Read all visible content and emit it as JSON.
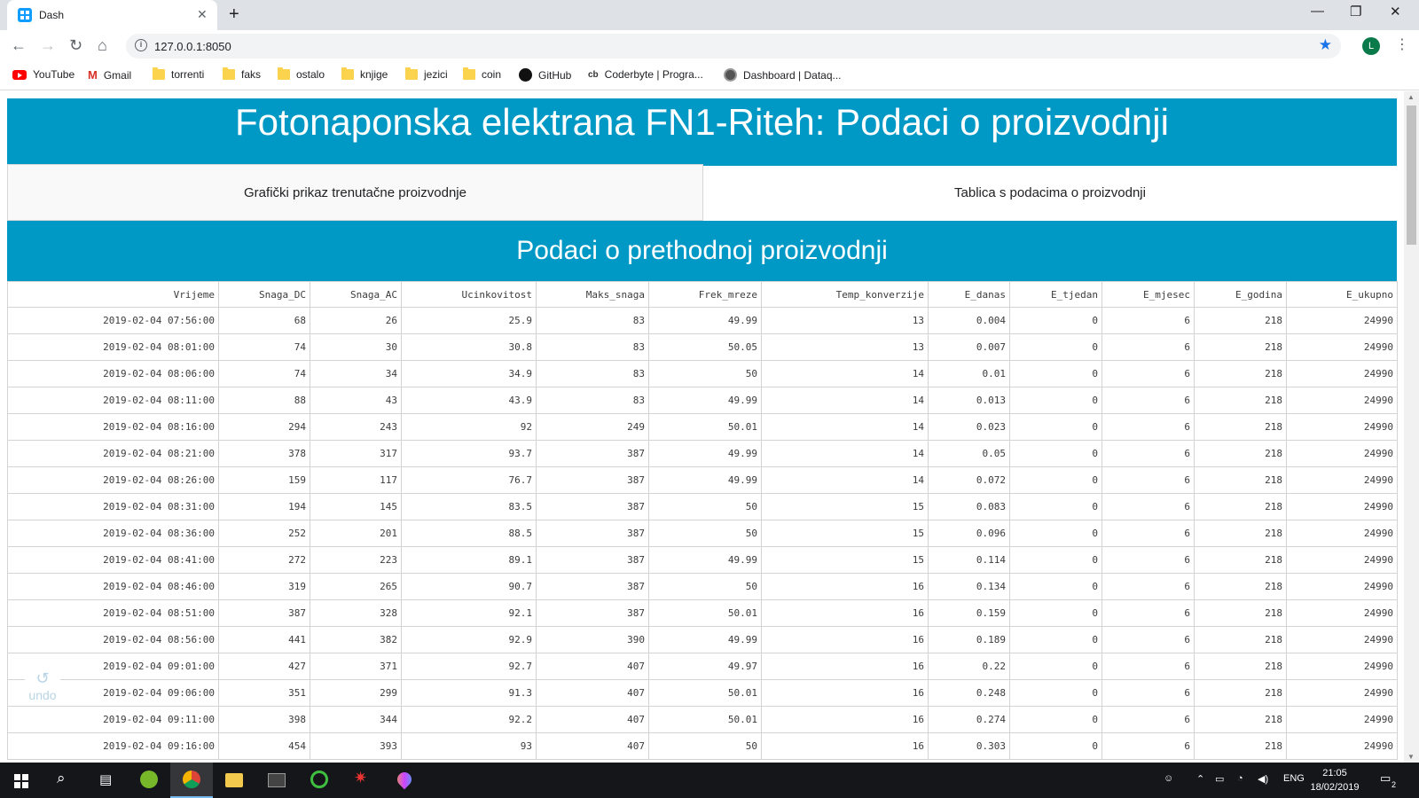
{
  "browser": {
    "tab_title": "Dash",
    "url": "127.0.0.1:8050",
    "profile_initial": "L",
    "bookmarks": [
      {
        "label": "YouTube",
        "icon": "youtube-icon"
      },
      {
        "label": "Gmail",
        "icon": "gmail-icon"
      },
      {
        "label": "torrenti",
        "icon": "folder-icon"
      },
      {
        "label": "faks",
        "icon": "folder-icon"
      },
      {
        "label": "ostalo",
        "icon": "folder-icon"
      },
      {
        "label": "knjige",
        "icon": "folder-icon"
      },
      {
        "label": "jezici",
        "icon": "folder-icon"
      },
      {
        "label": "coin",
        "icon": "folder-icon"
      },
      {
        "label": "GitHub",
        "icon": "github-icon"
      },
      {
        "label": "Coderbyte | Progra...",
        "icon": "coderbyte-icon"
      },
      {
        "label": "Dashboard | Dataq...",
        "icon": "dataquest-icon"
      }
    ]
  },
  "page": {
    "title": "Fotonaponska elektrana FN1-Riteh: Podaci o proizvodnji",
    "tabs": [
      {
        "label": "Grafički prikaz trenutačne proizvodnje",
        "active": false
      },
      {
        "label": "Tablica s podacima o proizvodnji",
        "active": true
      }
    ],
    "section_title": "Podaci o prethodnoj proizvodnji",
    "undo_label": "undo",
    "accent_color": "#0099c6"
  },
  "table": {
    "columns": [
      "Vrijeme",
      "Snaga_DC",
      "Snaga_AC",
      "Ucinkovitost",
      "Maks_snaga",
      "Frek_mreze",
      "Temp_konverzije",
      "E_danas",
      "E_tjedan",
      "E_mjesec",
      "E_godina",
      "E_ukupno"
    ],
    "rows": [
      [
        "2019-02-04 07:56:00",
        "68",
        "26",
        "25.9",
        "83",
        "49.99",
        "13",
        "0.004",
        "0",
        "6",
        "218",
        "24990"
      ],
      [
        "2019-02-04 08:01:00",
        "74",
        "30",
        "30.8",
        "83",
        "50.05",
        "13",
        "0.007",
        "0",
        "6",
        "218",
        "24990"
      ],
      [
        "2019-02-04 08:06:00",
        "74",
        "34",
        "34.9",
        "83",
        "50",
        "14",
        "0.01",
        "0",
        "6",
        "218",
        "24990"
      ],
      [
        "2019-02-04 08:11:00",
        "88",
        "43",
        "43.9",
        "83",
        "49.99",
        "14",
        "0.013",
        "0",
        "6",
        "218",
        "24990"
      ],
      [
        "2019-02-04 08:16:00",
        "294",
        "243",
        "92",
        "249",
        "50.01",
        "14",
        "0.023",
        "0",
        "6",
        "218",
        "24990"
      ],
      [
        "2019-02-04 08:21:00",
        "378",
        "317",
        "93.7",
        "387",
        "49.99",
        "14",
        "0.05",
        "0",
        "6",
        "218",
        "24990"
      ],
      [
        "2019-02-04 08:26:00",
        "159",
        "117",
        "76.7",
        "387",
        "49.99",
        "14",
        "0.072",
        "0",
        "6",
        "218",
        "24990"
      ],
      [
        "2019-02-04 08:31:00",
        "194",
        "145",
        "83.5",
        "387",
        "50",
        "15",
        "0.083",
        "0",
        "6",
        "218",
        "24990"
      ],
      [
        "2019-02-04 08:36:00",
        "252",
        "201",
        "88.5",
        "387",
        "50",
        "15",
        "0.096",
        "0",
        "6",
        "218",
        "24990"
      ],
      [
        "2019-02-04 08:41:00",
        "272",
        "223",
        "89.1",
        "387",
        "49.99",
        "15",
        "0.114",
        "0",
        "6",
        "218",
        "24990"
      ],
      [
        "2019-02-04 08:46:00",
        "319",
        "265",
        "90.7",
        "387",
        "50",
        "16",
        "0.134",
        "0",
        "6",
        "218",
        "24990"
      ],
      [
        "2019-02-04 08:51:00",
        "387",
        "328",
        "92.1",
        "387",
        "50.01",
        "16",
        "0.159",
        "0",
        "6",
        "218",
        "24990"
      ],
      [
        "2019-02-04 08:56:00",
        "441",
        "382",
        "92.9",
        "390",
        "49.99",
        "16",
        "0.189",
        "0",
        "6",
        "218",
        "24990"
      ],
      [
        "2019-02-04 09:01:00",
        "427",
        "371",
        "92.7",
        "407",
        "49.97",
        "16",
        "0.22",
        "0",
        "6",
        "218",
        "24990"
      ],
      [
        "2019-02-04 09:06:00",
        "351",
        "299",
        "91.3",
        "407",
        "50.01",
        "16",
        "0.248",
        "0",
        "6",
        "218",
        "24990"
      ],
      [
        "2019-02-04 09:11:00",
        "398",
        "344",
        "92.2",
        "407",
        "50.01",
        "16",
        "0.274",
        "0",
        "6",
        "218",
        "24990"
      ],
      [
        "2019-02-04 09:16:00",
        "454",
        "393",
        "93",
        "407",
        "50",
        "16",
        "0.303",
        "0",
        "6",
        "218",
        "24990"
      ]
    ]
  },
  "taskbar": {
    "apps": [
      "windows-start-icon",
      "search-icon",
      "task-view-icon",
      "utorrent-icon",
      "chrome-icon",
      "file-explorer-icon",
      "terminal-icon",
      "circle-app-icon",
      "spider-app-icon",
      "balloon-app-icon"
    ],
    "language": "ENG",
    "time": "21:05",
    "date": "18/02/2019",
    "notification_count": "2"
  }
}
